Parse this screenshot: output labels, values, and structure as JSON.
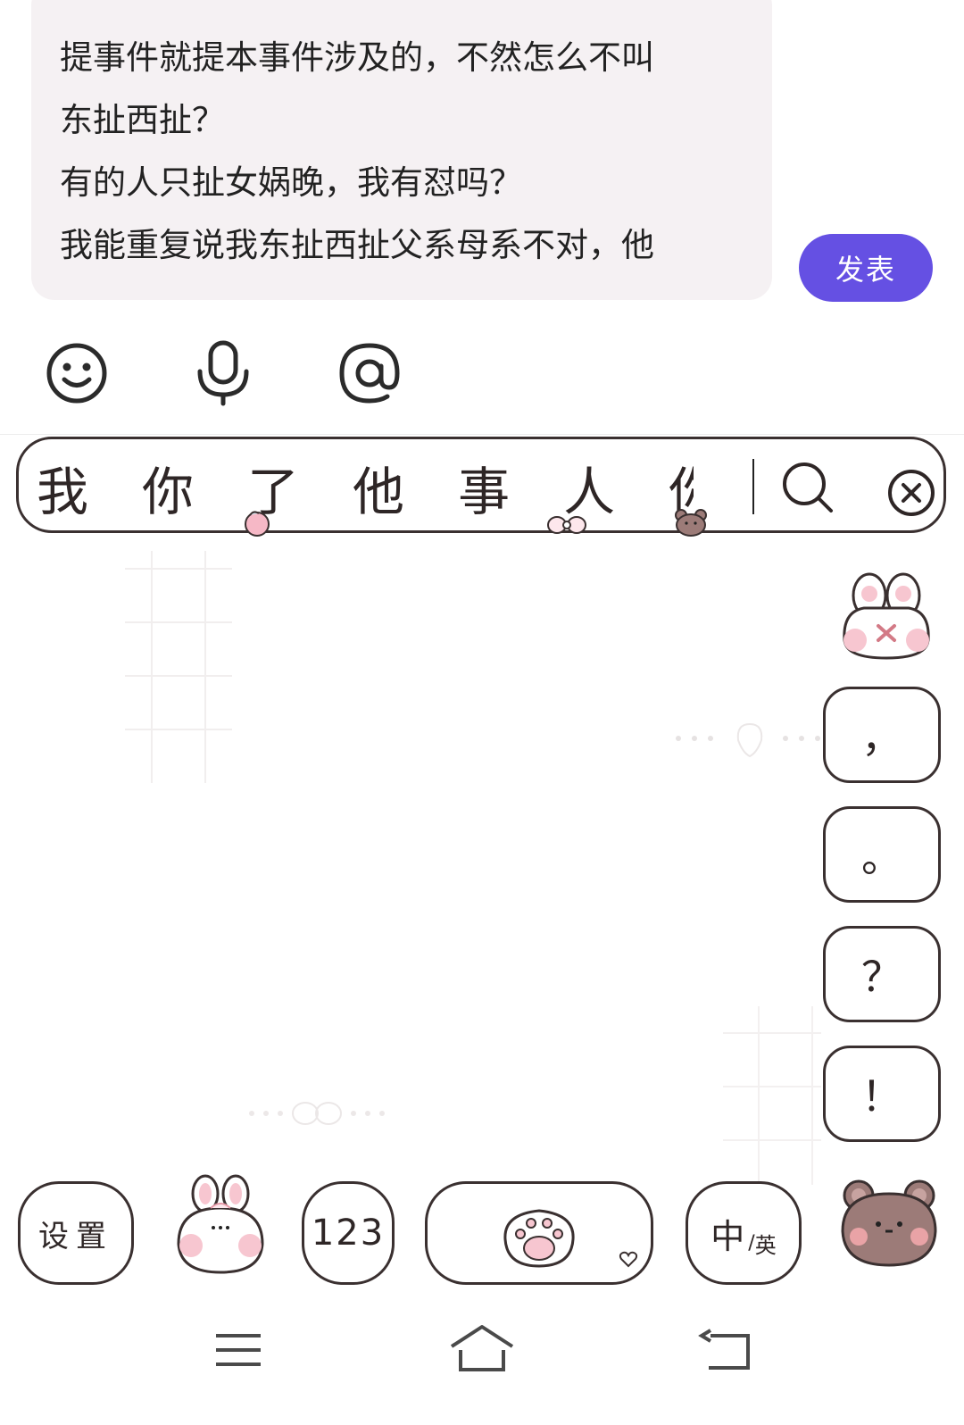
{
  "composer": {
    "lines": [
      "提事件就提本事件涉及的，不然怎么不叫",
      "东扯西扯？",
      "有的人只扯女娲晚，我有怼吗？",
      "我能重复说我东扯西扯父系母系不对，他"
    ],
    "post_button": "发表",
    "tools": [
      "emoji-icon",
      "microphone-icon",
      "at-sign-icon"
    ]
  },
  "keyboard": {
    "candidates": [
      "我",
      "你",
      "了",
      "他",
      "事",
      "人",
      "你"
    ],
    "punctuation": [
      "，",
      "。",
      "？",
      "！"
    ],
    "settings_label": "设置",
    "numbers_label": "123",
    "lang_zh": "中",
    "lang_sep": "/",
    "lang_en": "英"
  },
  "nav": [
    "menu-icon",
    "home-icon",
    "back-icon"
  ],
  "colors": {
    "accent": "#6550e3",
    "bubble": "#f5f1f3",
    "key_outline": "#3a3030",
    "pink": "#f7c6d0",
    "bear": "#9c7b78"
  }
}
